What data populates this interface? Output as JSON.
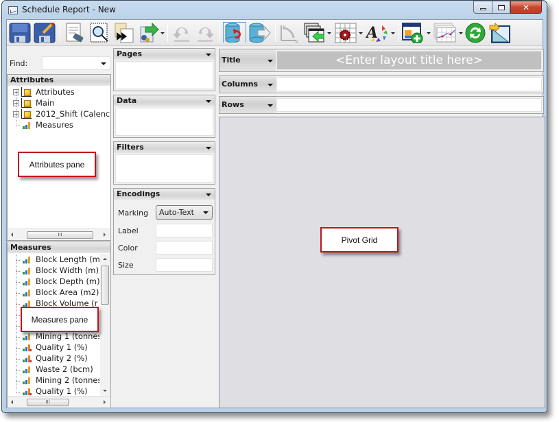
{
  "window": {
    "title": "Schedule Report - New",
    "controls": {
      "minimize": "minimize",
      "maximize": "maximize",
      "close": "x"
    }
  },
  "toolbar": {
    "buttons": [
      {
        "name": "save",
        "icon": "floppy-disk-icon"
      },
      {
        "name": "save-as",
        "icon": "floppy-disk-pencil-icon"
      },
      {
        "name": "clear-layout",
        "icon": "document-eraser-icon"
      },
      {
        "name": "preview",
        "icon": "zoom-preview-icon"
      },
      {
        "name": "run-report",
        "icon": "document-forward-icon"
      },
      {
        "name": "export",
        "icon": "export-arrow-icon",
        "dropdown": true
      },
      {
        "name": "undo",
        "icon": "undo-icon",
        "disabled": true
      },
      {
        "name": "redo",
        "icon": "redo-icon",
        "disabled": true
      },
      {
        "name": "reload-data",
        "icon": "database-refresh-icon",
        "active": true
      },
      {
        "name": "export-data",
        "icon": "database-export-icon"
      },
      {
        "name": "swap-axes",
        "icon": "swap-axes-icon",
        "disabled": true
      },
      {
        "name": "import-layout",
        "icon": "windows-import-icon",
        "dropdown": true
      },
      {
        "name": "grid-settings",
        "icon": "grid-gear-icon",
        "dropdown": true
      },
      {
        "name": "format-colors",
        "icon": "font-color-wheel-icon",
        "dropdown": true
      },
      {
        "name": "add-view",
        "icon": "window-add-icon",
        "dropdown": true
      },
      {
        "name": "chart-type",
        "icon": "line-chart-icon",
        "dropdown": true
      },
      {
        "name": "refresh",
        "icon": "green-refresh-icon"
      },
      {
        "name": "chart-area",
        "icon": "area-chart-icon"
      }
    ]
  },
  "find": {
    "label": "Find:",
    "value": ""
  },
  "attributes_pane": {
    "header": "Attributes",
    "items": [
      {
        "label": "Attributes",
        "expandable": true,
        "icon": "dimension-cube-icon"
      },
      {
        "label": "Main",
        "expandable": true,
        "icon": "dimension-cube-icon"
      },
      {
        "label": "2012_Shift (Calenc",
        "expandable": true,
        "icon": "dimension-cube-icon"
      },
      {
        "label": "Measures",
        "expandable": false,
        "icon": "measure-bars-icon"
      }
    ],
    "callout": "Attributes pane"
  },
  "measures_pane": {
    "header": "Measures",
    "items": [
      {
        "label": "Block Length (m",
        "icon": "measure-bars-icon"
      },
      {
        "label": "Block Width (m)",
        "icon": "measure-bars-icon"
      },
      {
        "label": "Block Depth (m)",
        "icon": "measure-bars-icon"
      },
      {
        "label": "Block Area (m2)",
        "icon": "measure-bars-icon"
      },
      {
        "label": "Block Volume (r",
        "icon": "measure-bars-icon"
      },
      {
        "label": "",
        "icon": "measure-bars-icon"
      },
      {
        "label": "",
        "icon": "measure-bars-icon"
      },
      {
        "label": "Mining 1 (tonnes",
        "icon": "measure-bars-icon"
      },
      {
        "label": "Quality 1 (%)",
        "icon": "calculated-measure-icon"
      },
      {
        "label": "Quality 2 (%)",
        "icon": "calculated-measure-icon"
      },
      {
        "label": "Waste 2 (bcm)",
        "icon": "measure-bars-icon"
      },
      {
        "label": "Mining 2 (tonnes",
        "icon": "measure-bars-icon"
      },
      {
        "label": "Quality 1 (%)",
        "icon": "calculated-measure-icon"
      }
    ],
    "callout": "Measures pane"
  },
  "shelves": {
    "pages": {
      "header": "Pages"
    },
    "data": {
      "header": "Data"
    },
    "filters": {
      "header": "Filters"
    },
    "encodings": {
      "header": "Encodings",
      "marking_label": "Marking",
      "marking_value": "Auto-Text",
      "label_label": "Label",
      "color_label": "Color",
      "size_label": "Size"
    }
  },
  "layout": {
    "title": {
      "label": "Title",
      "placeholder": "<Enter layout title here>"
    },
    "columns": {
      "label": "Columns",
      "value": ""
    },
    "rows": {
      "label": "Rows",
      "value": ""
    }
  },
  "pivot_grid": {
    "callout": "Pivot Grid"
  },
  "colors": {
    "callout_border": "#c1121a",
    "title_field_bg": "#c0c0c0",
    "pivot_bg": "#dfdfe3",
    "window_frame": "#bcd3ea"
  }
}
